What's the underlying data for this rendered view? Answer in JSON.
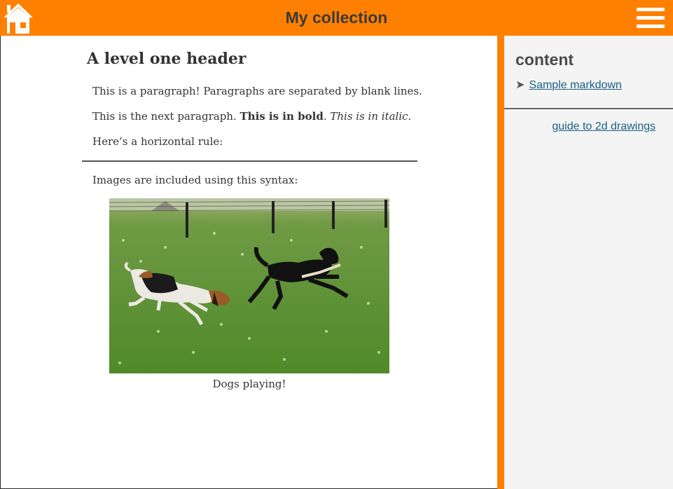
{
  "header": {
    "title": "My collection",
    "home_icon": "home-icon",
    "menu_icon": "hamburger-menu-icon",
    "bar_color": "#ff8000"
  },
  "main": {
    "heading": "A level one header",
    "paragraph_1": "This is a paragraph! Paragraphs are separated by blank lines.",
    "paragraph_2_prefix": "This is the next paragraph. ",
    "paragraph_2_bold": "This is in bold",
    "paragraph_2_mid": ". ",
    "paragraph_2_italic": "This is in italic",
    "paragraph_2_suffix": ".",
    "paragraph_3": "Here’s a horizontal rule:",
    "paragraph_4": "Images are included using this syntax:",
    "image_caption": "Dogs playing!"
  },
  "sidebar": {
    "title": "content",
    "toc_items": [
      {
        "label": "Sample markdown"
      }
    ],
    "guide_link": "guide to 2d drawings",
    "link_color": "#1a5e82"
  }
}
